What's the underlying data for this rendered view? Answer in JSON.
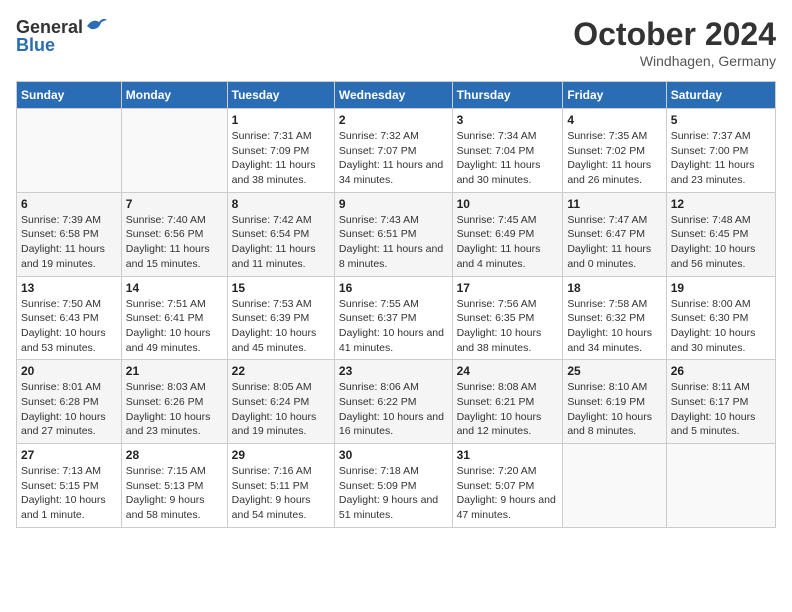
{
  "header": {
    "logo_general": "General",
    "logo_blue": "Blue",
    "month": "October 2024",
    "location": "Windhagen, Germany"
  },
  "weekdays": [
    "Sunday",
    "Monday",
    "Tuesday",
    "Wednesday",
    "Thursday",
    "Friday",
    "Saturday"
  ],
  "weeks": [
    [
      {
        "day": "",
        "sunrise": "",
        "sunset": "",
        "daylight": ""
      },
      {
        "day": "",
        "sunrise": "",
        "sunset": "",
        "daylight": ""
      },
      {
        "day": "1",
        "sunrise": "Sunrise: 7:31 AM",
        "sunset": "Sunset: 7:09 PM",
        "daylight": "Daylight: 11 hours and 38 minutes."
      },
      {
        "day": "2",
        "sunrise": "Sunrise: 7:32 AM",
        "sunset": "Sunset: 7:07 PM",
        "daylight": "Daylight: 11 hours and 34 minutes."
      },
      {
        "day": "3",
        "sunrise": "Sunrise: 7:34 AM",
        "sunset": "Sunset: 7:04 PM",
        "daylight": "Daylight: 11 hours and 30 minutes."
      },
      {
        "day": "4",
        "sunrise": "Sunrise: 7:35 AM",
        "sunset": "Sunset: 7:02 PM",
        "daylight": "Daylight: 11 hours and 26 minutes."
      },
      {
        "day": "5",
        "sunrise": "Sunrise: 7:37 AM",
        "sunset": "Sunset: 7:00 PM",
        "daylight": "Daylight: 11 hours and 23 minutes."
      }
    ],
    [
      {
        "day": "6",
        "sunrise": "Sunrise: 7:39 AM",
        "sunset": "Sunset: 6:58 PM",
        "daylight": "Daylight: 11 hours and 19 minutes."
      },
      {
        "day": "7",
        "sunrise": "Sunrise: 7:40 AM",
        "sunset": "Sunset: 6:56 PM",
        "daylight": "Daylight: 11 hours and 15 minutes."
      },
      {
        "day": "8",
        "sunrise": "Sunrise: 7:42 AM",
        "sunset": "Sunset: 6:54 PM",
        "daylight": "Daylight: 11 hours and 11 minutes."
      },
      {
        "day": "9",
        "sunrise": "Sunrise: 7:43 AM",
        "sunset": "Sunset: 6:51 PM",
        "daylight": "Daylight: 11 hours and 8 minutes."
      },
      {
        "day": "10",
        "sunrise": "Sunrise: 7:45 AM",
        "sunset": "Sunset: 6:49 PM",
        "daylight": "Daylight: 11 hours and 4 minutes."
      },
      {
        "day": "11",
        "sunrise": "Sunrise: 7:47 AM",
        "sunset": "Sunset: 6:47 PM",
        "daylight": "Daylight: 11 hours and 0 minutes."
      },
      {
        "day": "12",
        "sunrise": "Sunrise: 7:48 AM",
        "sunset": "Sunset: 6:45 PM",
        "daylight": "Daylight: 10 hours and 56 minutes."
      }
    ],
    [
      {
        "day": "13",
        "sunrise": "Sunrise: 7:50 AM",
        "sunset": "Sunset: 6:43 PM",
        "daylight": "Daylight: 10 hours and 53 minutes."
      },
      {
        "day": "14",
        "sunrise": "Sunrise: 7:51 AM",
        "sunset": "Sunset: 6:41 PM",
        "daylight": "Daylight: 10 hours and 49 minutes."
      },
      {
        "day": "15",
        "sunrise": "Sunrise: 7:53 AM",
        "sunset": "Sunset: 6:39 PM",
        "daylight": "Daylight: 10 hours and 45 minutes."
      },
      {
        "day": "16",
        "sunrise": "Sunrise: 7:55 AM",
        "sunset": "Sunset: 6:37 PM",
        "daylight": "Daylight: 10 hours and 41 minutes."
      },
      {
        "day": "17",
        "sunrise": "Sunrise: 7:56 AM",
        "sunset": "Sunset: 6:35 PM",
        "daylight": "Daylight: 10 hours and 38 minutes."
      },
      {
        "day": "18",
        "sunrise": "Sunrise: 7:58 AM",
        "sunset": "Sunset: 6:32 PM",
        "daylight": "Daylight: 10 hours and 34 minutes."
      },
      {
        "day": "19",
        "sunrise": "Sunrise: 8:00 AM",
        "sunset": "Sunset: 6:30 PM",
        "daylight": "Daylight: 10 hours and 30 minutes."
      }
    ],
    [
      {
        "day": "20",
        "sunrise": "Sunrise: 8:01 AM",
        "sunset": "Sunset: 6:28 PM",
        "daylight": "Daylight: 10 hours and 27 minutes."
      },
      {
        "day": "21",
        "sunrise": "Sunrise: 8:03 AM",
        "sunset": "Sunset: 6:26 PM",
        "daylight": "Daylight: 10 hours and 23 minutes."
      },
      {
        "day": "22",
        "sunrise": "Sunrise: 8:05 AM",
        "sunset": "Sunset: 6:24 PM",
        "daylight": "Daylight: 10 hours and 19 minutes."
      },
      {
        "day": "23",
        "sunrise": "Sunrise: 8:06 AM",
        "sunset": "Sunset: 6:22 PM",
        "daylight": "Daylight: 10 hours and 16 minutes."
      },
      {
        "day": "24",
        "sunrise": "Sunrise: 8:08 AM",
        "sunset": "Sunset: 6:21 PM",
        "daylight": "Daylight: 10 hours and 12 minutes."
      },
      {
        "day": "25",
        "sunrise": "Sunrise: 8:10 AM",
        "sunset": "Sunset: 6:19 PM",
        "daylight": "Daylight: 10 hours and 8 minutes."
      },
      {
        "day": "26",
        "sunrise": "Sunrise: 8:11 AM",
        "sunset": "Sunset: 6:17 PM",
        "daylight": "Daylight: 10 hours and 5 minutes."
      }
    ],
    [
      {
        "day": "27",
        "sunrise": "Sunrise: 7:13 AM",
        "sunset": "Sunset: 5:15 PM",
        "daylight": "Daylight: 10 hours and 1 minute."
      },
      {
        "day": "28",
        "sunrise": "Sunrise: 7:15 AM",
        "sunset": "Sunset: 5:13 PM",
        "daylight": "Daylight: 9 hours and 58 minutes."
      },
      {
        "day": "29",
        "sunrise": "Sunrise: 7:16 AM",
        "sunset": "Sunset: 5:11 PM",
        "daylight": "Daylight: 9 hours and 54 minutes."
      },
      {
        "day": "30",
        "sunrise": "Sunrise: 7:18 AM",
        "sunset": "Sunset: 5:09 PM",
        "daylight": "Daylight: 9 hours and 51 minutes."
      },
      {
        "day": "31",
        "sunrise": "Sunrise: 7:20 AM",
        "sunset": "Sunset: 5:07 PM",
        "daylight": "Daylight: 9 hours and 47 minutes."
      },
      {
        "day": "",
        "sunrise": "",
        "sunset": "",
        "daylight": ""
      },
      {
        "day": "",
        "sunrise": "",
        "sunset": "",
        "daylight": ""
      }
    ]
  ]
}
